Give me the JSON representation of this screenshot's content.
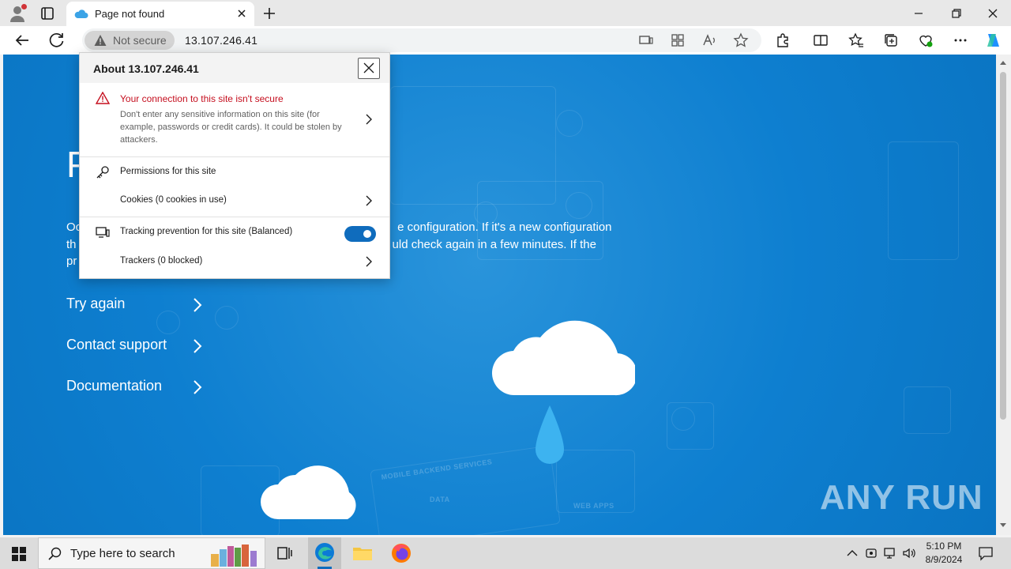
{
  "browser": {
    "tab_title": "Page not found",
    "security_label": "Not secure",
    "url": "13.107.246.41"
  },
  "popup": {
    "title": "About 13.107.246.41",
    "warning_title": "Your connection to this site isn't secure",
    "warning_text": "Don't enter any sensitive information on this site (for example, passwords or credit cards). It could be stolen by attackers.",
    "permissions_label": "Permissions for this site",
    "cookies_label": "Cookies (0 cookies in use)",
    "tracking_label": "Tracking prevention for this site (Balanced)",
    "tracking_enabled": true,
    "trackers_label": "Trackers (0 blocked)"
  },
  "page": {
    "title_fragment": "P",
    "para_line1_start": "Oc",
    "para_line1_end": "e configuration. If it's a new configuration",
    "para_line2_start": "th",
    "para_line2_end": "uld check again in a few minutes. If the",
    "para_line3_start": "pr",
    "links": [
      "Try again",
      "Contact support",
      "Documentation"
    ],
    "bg_label_1": "MOBILE BACKEND SERVICES",
    "bg_label_2": "DATA",
    "bg_label_3": "WEB APPS"
  },
  "watermark": "ANY RUN",
  "taskbar": {
    "search_placeholder": "Type here to search",
    "time": "5:10 PM",
    "date": "8/9/2024"
  },
  "colors": {
    "page_blue": "#0e7fd0",
    "accent": "#0f6cbd",
    "warning_red": "#c50f1f"
  }
}
